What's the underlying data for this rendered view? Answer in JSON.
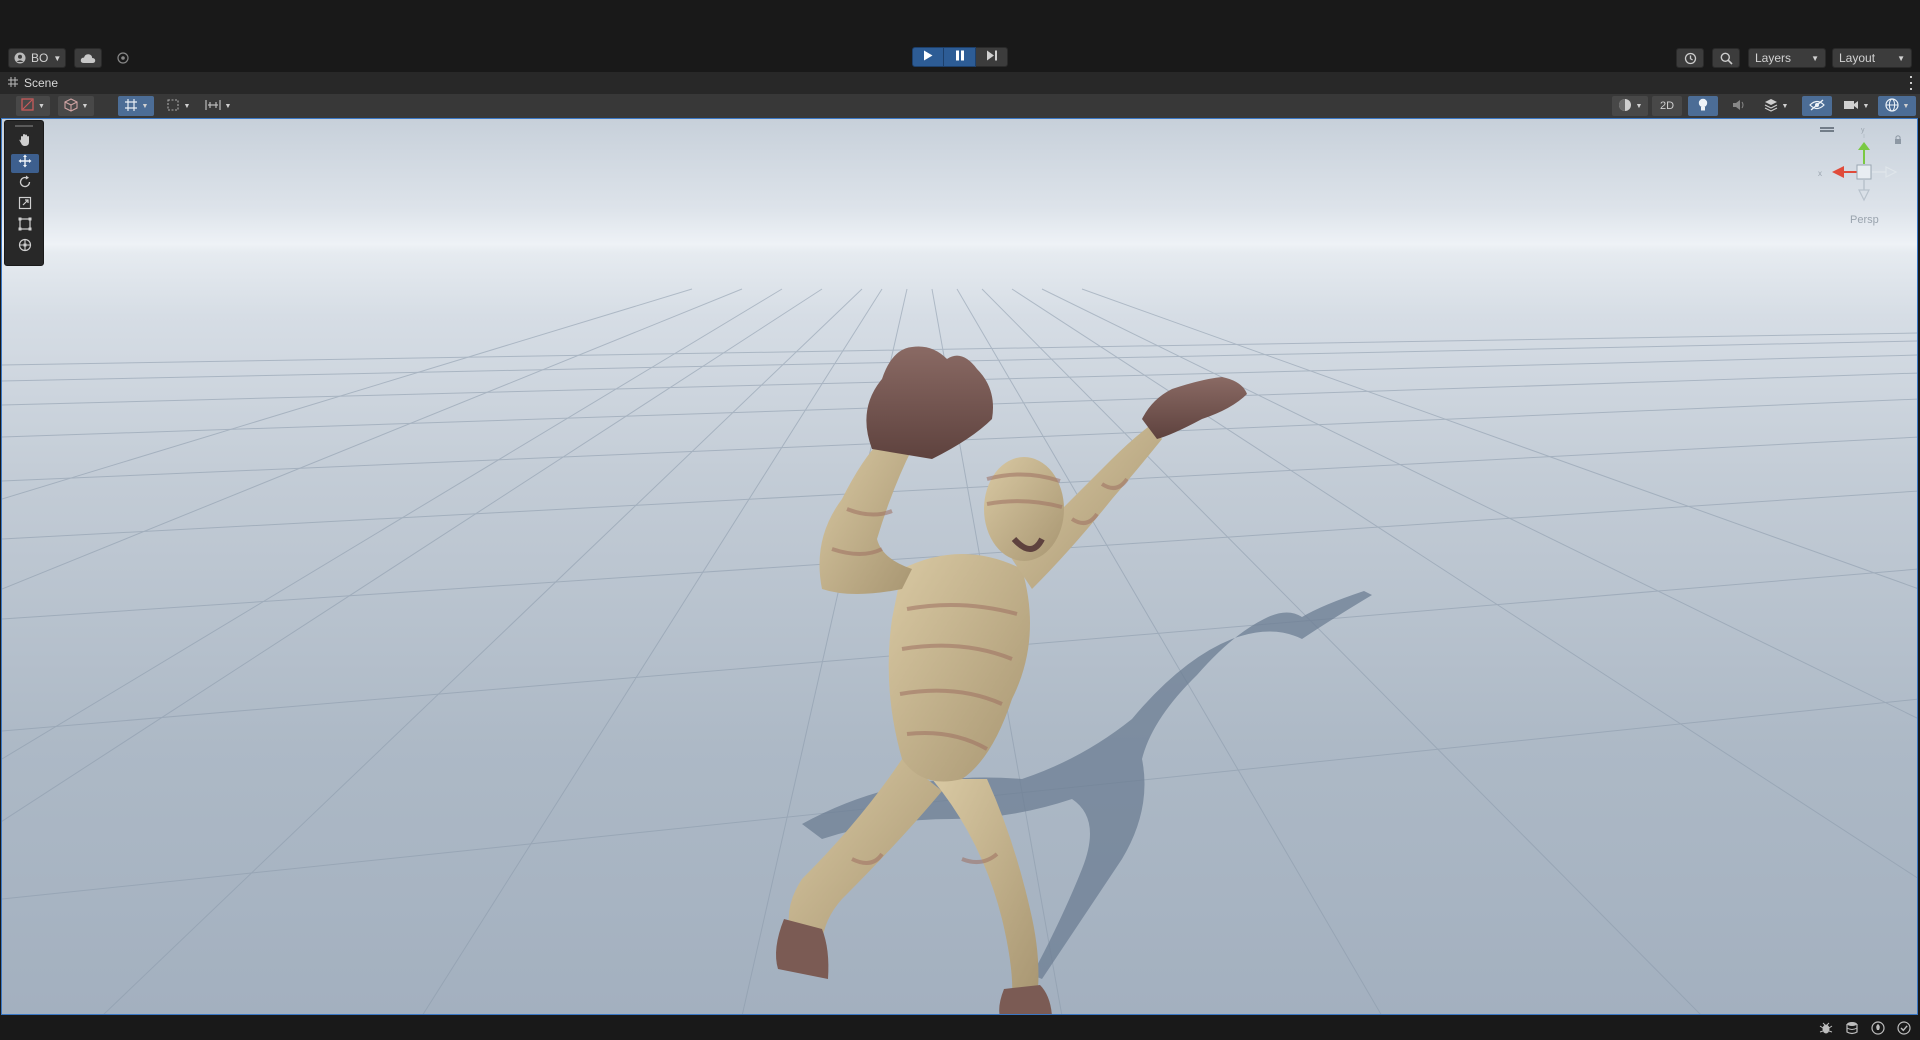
{
  "title_bar": {
    "account_label": "BO",
    "account_icon": "user-icon",
    "cloud_icon": "cloud-icon",
    "collab_icon": "services-icon"
  },
  "playmode": {
    "play_icon": "play-icon",
    "pause_icon": "pause-icon",
    "step_icon": "step-icon",
    "play_active": true,
    "pause_active": true
  },
  "right_toolbar": {
    "history_icon": "history-icon",
    "search_icon": "search-icon",
    "layers_label": "Layers",
    "layout_label": "Layout"
  },
  "window": {
    "tab_label": "Scene",
    "tab_icon": "scene-grid-icon"
  },
  "scene_toolbar": {
    "draw_mode_icon": "draw-mode-icon",
    "shading_icon": "cube-icon",
    "grid_icon": "grid-snap-icon",
    "increment_icon": "increment-snap-icon",
    "gizmo_toggle_icon": "toggle-icon",
    "shading_mode_icon": "sphere-icon",
    "mode_2d_label": "2D",
    "lighting_icon": "lightbulb-icon",
    "audio_icon": "audio-icon",
    "effects_icon": "layers-icon",
    "hidden_icon": "eye-hidden-icon",
    "camera_icon": "camera-icon",
    "gizmos_icon": "globe-icon"
  },
  "tools": [
    {
      "name": "hand-tool",
      "icon": "hand-icon",
      "active": false
    },
    {
      "name": "move-tool",
      "icon": "move-icon",
      "active": true
    },
    {
      "name": "rotate-tool",
      "icon": "rotate-icon",
      "active": false
    },
    {
      "name": "scale-tool",
      "icon": "scale-icon",
      "active": false
    },
    {
      "name": "rect-tool",
      "icon": "rect-icon",
      "active": false
    },
    {
      "name": "transform-tool",
      "icon": "transform-icon",
      "active": false
    }
  ],
  "viewport": {
    "projection_label": "Persp",
    "gizmo_lock_icon": "lock-icon",
    "subject": "mummy character model with raised arms",
    "colors": {
      "sky_top": "#c7d0da",
      "horizon": "#eef2f6",
      "ground": "#aab6c3",
      "grid_line": "#8b9aab",
      "selection_border": "#3a77c4"
    }
  },
  "status_bar": {
    "icons": [
      "bug-icon",
      "database-icon",
      "lightbulb-icon",
      "check-circle-icon"
    ]
  }
}
